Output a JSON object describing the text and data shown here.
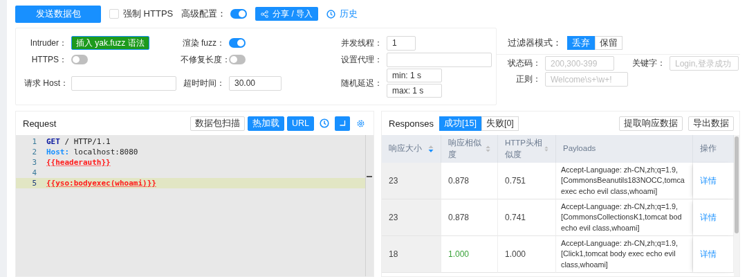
{
  "toolbar": {
    "send_button": "发送数据包",
    "force_https": {
      "label": "强制 HTTPS",
      "checked": false
    },
    "advanced": {
      "label": "高级配置：",
      "on": true
    },
    "share_button": "分享 / 导入",
    "history_link": "历史"
  },
  "config": {
    "fields": [
      {
        "label": "Intruder：",
        "kind": "action",
        "value": "插入 yak.fuzz 语法"
      },
      {
        "label": "渲染 fuzz：",
        "kind": "switch",
        "on": true
      },
      {
        "label": "并发线程：",
        "kind": "input",
        "value": "1"
      },
      {
        "label": "HTTPS：",
        "kind": "switch",
        "on": false
      },
      {
        "label": "不修复长度：",
        "kind": "switch",
        "on": false
      },
      {
        "label": "设置代理：",
        "kind": "input"
      },
      {
        "label": "请求 Host：",
        "kind": "input"
      },
      {
        "label": "超时时间：",
        "kind": "input",
        "value": "30.00"
      },
      {
        "label": "随机延迟：",
        "kind": "range",
        "min": "min: 1 s",
        "max": "max: 1 s"
      }
    ]
  },
  "filter": {
    "title": "过滤器模式：",
    "modes": [
      {
        "label": "丢弃",
        "selected": true
      },
      {
        "label": "保留",
        "selected": false
      }
    ],
    "fields": [
      {
        "label": "状态码：",
        "placeholder": "200,300-399"
      },
      {
        "label": "关键字：",
        "placeholder": "Login,登录成功"
      },
      {
        "label": "正则：",
        "placeholder": "Welcome\\s+\\w+!"
      }
    ]
  },
  "request": {
    "title": "Request",
    "buttons": [
      {
        "label": "数据包扫描",
        "kind": "plain"
      },
      {
        "label": "热加载",
        "kind": "primary"
      },
      {
        "label": "URL",
        "kind": "primary"
      }
    ],
    "lines": [
      {
        "number": "1",
        "current": false,
        "tokens": [
          {
            "kind": "method",
            "text": "GET"
          },
          {
            "kind": "text",
            "text": " / HTTP/1.1"
          }
        ]
      },
      {
        "number": "2",
        "current": false,
        "tokens": [
          {
            "kind": "header",
            "text": "Host:"
          },
          {
            "kind": "text",
            "text": " localhost:8080"
          }
        ]
      },
      {
        "number": "3",
        "current": false,
        "tokens": [
          {
            "kind": "fuzz",
            "text": "{{headerauth}}"
          }
        ]
      },
      {
        "number": "4",
        "current": false
      },
      {
        "number": "5",
        "current": true,
        "tokens": [
          {
            "kind": "fuzz",
            "text": "{{yso:bodyexec(whoami)}}"
          }
        ]
      }
    ]
  },
  "responses": {
    "title": "Responses",
    "tabs": [
      {
        "label": "成功[15]",
        "selected": true
      },
      {
        "label": "失败[0]",
        "selected": false
      }
    ],
    "buttons": [
      "提取响应数据",
      "导出数据"
    ],
    "columns": [
      {
        "label": "响应大小",
        "sorted": true
      },
      {
        "label": "响应相似度",
        "sorted": false
      },
      {
        "label": "HTTP头相似度",
        "sorted": false
      },
      {
        "label": "Payloads"
      },
      {
        "label": "操作"
      }
    ],
    "rows": [
      {
        "size": "23",
        "body_similarity": "0.878",
        "header_similarity": "0.751",
        "exact_match": false,
        "payload": "Accept-Language: zh-CN,zh;q=1.9,\n[CommonsBeanutils183NOCC,tomca\nexec echo evil class,whoami]",
        "action": "详情"
      },
      {
        "size": "23",
        "body_similarity": "0.878",
        "header_similarity": "0.741",
        "exact_match": false,
        "payload": "Accept-Language: zh-CN,zh;q=1.9,\n[CommonsCollectionsK1,tomcat bod\necho evil class,whoami]",
        "action": "详情"
      },
      {
        "size": "18",
        "body_similarity": "1.000",
        "header_similarity": "1.000",
        "exact_match": true,
        "payload": "Accept-Language: zh-CN,zh;q=1.9,\n[Click1,tomcat body exec echo evil\nclass,whoami]",
        "action": "详情"
      }
    ]
  }
}
